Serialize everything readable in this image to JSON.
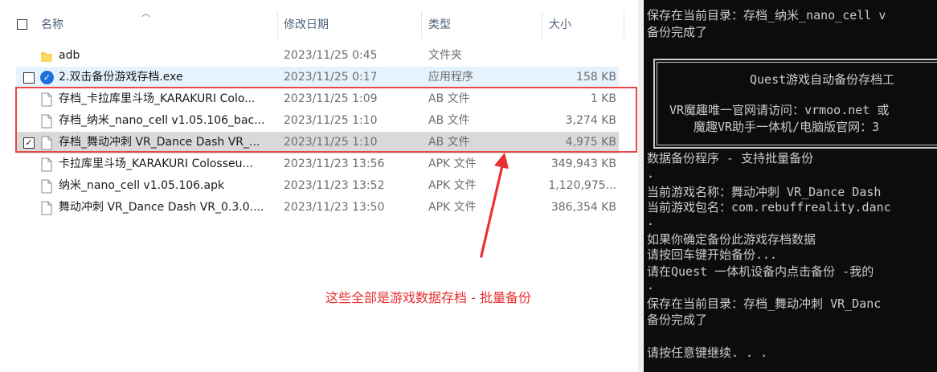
{
  "explorer": {
    "columns": {
      "name": "名称",
      "date": "修改日期",
      "type": "类型",
      "size": "大小"
    },
    "rows": [
      {
        "name": "adb",
        "date": "2023/11/25 0:45",
        "type": "文件夹",
        "size": "",
        "icon": "folder-icon"
      },
      {
        "name": "2.双击备份游戏存档.exe",
        "date": "2023/11/25 0:17",
        "type": "应用程序",
        "size": "158 KB",
        "icon": "check-circle-icon"
      },
      {
        "name": "存档_卡拉库里斗场_KARAKURI Colo...",
        "date": "2023/11/25 1:09",
        "type": "AB 文件",
        "size": "1 KB",
        "icon": "file-icon"
      },
      {
        "name": "存档_纳米_nano_cell v1.05.106_bac...",
        "date": "2023/11/25 1:10",
        "type": "AB 文件",
        "size": "3,274 KB",
        "icon": "file-icon"
      },
      {
        "name": "存档_舞动冲刺 VR_Dance Dash VR_...",
        "date": "2023/11/25 1:10",
        "type": "AB 文件",
        "size": "4,975 KB",
        "icon": "file-icon"
      },
      {
        "name": "卡拉库里斗场_KARAKURI Colosseu...",
        "date": "2023/11/23 13:56",
        "type": "APK 文件",
        "size": "349,943 KB",
        "icon": "file-icon"
      },
      {
        "name": "纳米_nano_cell v1.05.106.apk",
        "date": "2023/11/23 13:52",
        "type": "APK 文件",
        "size": "1,120,975...",
        "icon": "file-icon"
      },
      {
        "name": "舞动冲刺 VR_Dance Dash VR_0.3.0....",
        "date": "2023/11/23 13:50",
        "type": "APK 文件",
        "size": "386,354 KB",
        "icon": "file-icon"
      }
    ],
    "annotation": "这些全部是游戏数据存档 - 批量备份",
    "colors": {
      "annotation": "#e83030",
      "hover": "#e5f3ff",
      "selected": "#d9d9d9"
    }
  },
  "console": {
    "line1": "保存在当前目录：存档_纳米_nano_cell v",
    "line2": "备份完成了",
    "box_title": "Quest游戏自动备份存档工",
    "box_line1": "VR魔趣唯一官网请访问：vrmoo.net 或",
    "box_line2": "魔趣VR助手一体机/电脑版官网：3",
    "program": "数据备份程序 - 支持批量备份",
    "dot1": ".",
    "game_name": "当前游戏名称：舞动冲刺 VR_Dance Dash",
    "game_pkg": "当前游戏包名：com.rebuffreality.danc",
    "dot2": ".",
    "confirm1": "如果你确定备份此游戏存档数据",
    "confirm2": "请按回车键开始备份...",
    "confirm3": "请在Quest 一体机设备内点击备份 -我的",
    "dot3": ".",
    "saved": "保存在当前目录：存档_舞动冲刺 VR_Danc",
    "done": "备份完成了",
    "cont": "请按任意键继续. . ."
  }
}
